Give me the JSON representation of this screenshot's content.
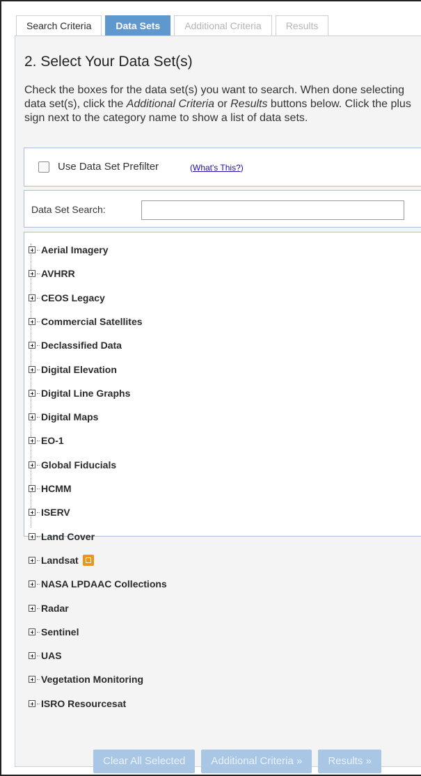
{
  "tabs": [
    {
      "label": "Search Criteria",
      "state": "normal"
    },
    {
      "label": "Data Sets",
      "state": "active"
    },
    {
      "label": "Additional Criteria",
      "state": "disabled"
    },
    {
      "label": "Results",
      "state": "disabled"
    }
  ],
  "heading": "2. Select Your Data Set(s)",
  "instructions": {
    "part1": "Check the boxes for the data set(s) you want to search. When done selecting data set(s), click the ",
    "em1": "Additional Criteria",
    "part2": " or ",
    "em2": "Results",
    "part3": " buttons below. Click the plus sign next to the category name to show a list of data sets."
  },
  "prefilter": {
    "label": "Use Data Set Prefilter",
    "help_open": "(",
    "help_link": "What's This?",
    "help_close": ")",
    "checked": false
  },
  "search": {
    "label": "Data Set Search:",
    "value": "",
    "placeholder": ""
  },
  "categories": [
    {
      "label": "Aerial Imagery"
    },
    {
      "label": "AVHRR"
    },
    {
      "label": "CEOS Legacy"
    },
    {
      "label": "Commercial Satellites"
    },
    {
      "label": "Declassified Data"
    },
    {
      "label": "Digital Elevation"
    },
    {
      "label": "Digital Line Graphs"
    },
    {
      "label": "Digital Maps"
    },
    {
      "label": "EO-1"
    },
    {
      "label": "Global Fiducials"
    },
    {
      "label": "HCMM"
    },
    {
      "label": "ISERV"
    },
    {
      "label": "Land Cover"
    },
    {
      "label": "Landsat",
      "badge": "orange-link-icon"
    },
    {
      "label": "NASA LPDAAC Collections"
    },
    {
      "label": "Radar"
    },
    {
      "label": "Sentinel"
    },
    {
      "label": "UAS"
    },
    {
      "label": "Vegetation Monitoring"
    },
    {
      "label": "ISRO Resourcesat"
    }
  ],
  "buttons": {
    "clear_label": "Clear All Selected",
    "additional_label": "Additional Criteria »",
    "results_label": "Results »"
  },
  "colors": {
    "active_tab": "#5f97cf",
    "button_disabled": "#a9c6e4",
    "badge": "#f0931b"
  }
}
